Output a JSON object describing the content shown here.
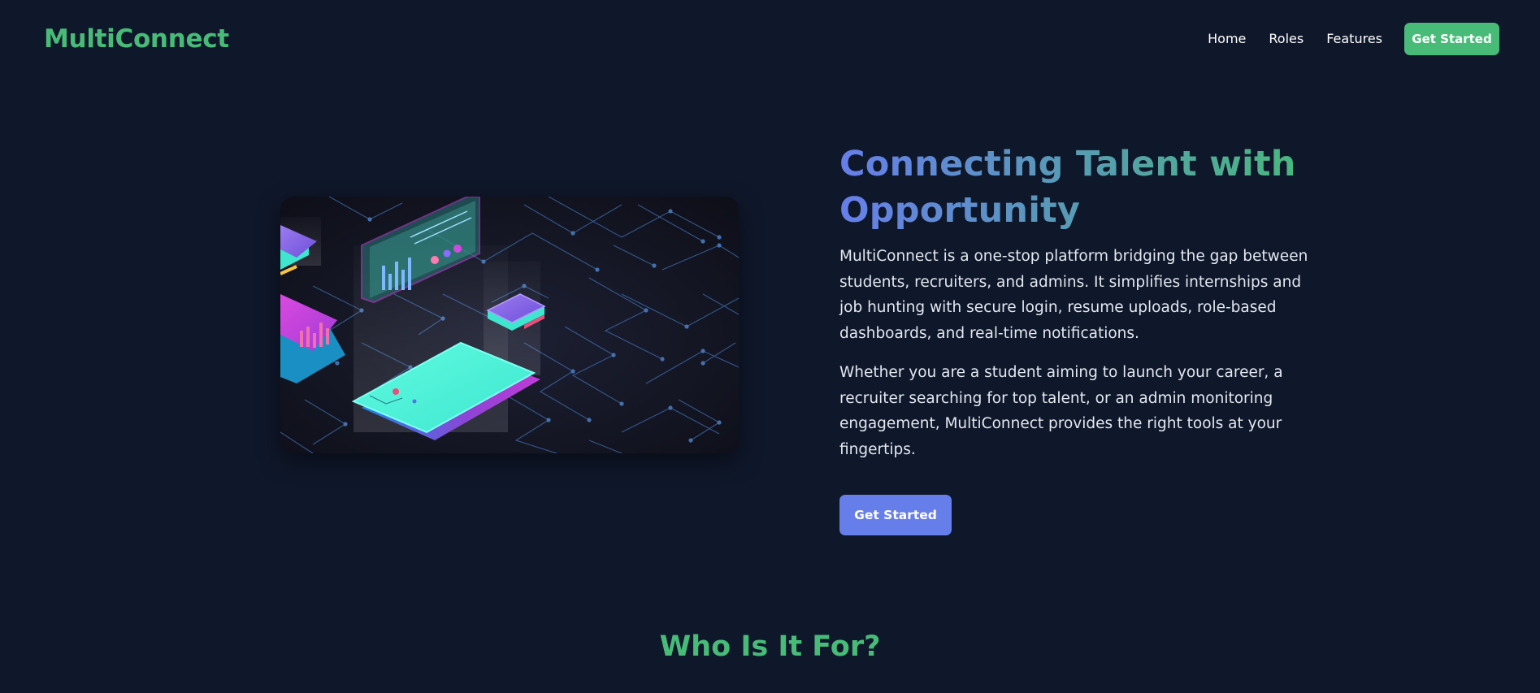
{
  "nav": {
    "brand": "MultiConnect",
    "links": [
      "Home",
      "Roles",
      "Features"
    ],
    "cta_label": "Get Started"
  },
  "hero": {
    "title": "Connecting Talent with Opportunity",
    "paragraphs": [
      "MultiConnect is a one-stop platform bridging the gap between students, recruiters, and admins. It simplifies internships and job hunting with secure login, resume uploads, role-based dashboards, and real-time notifications.",
      "Whether you are a student aiming to launch your career, a recruiter searching for top talent, or an admin monitoring engagement, MultiConnect provides the right tools at your fingertips."
    ],
    "cta_label": "Get Started",
    "image_icon": "isometric-tech-illustration"
  },
  "section": {
    "title": "Who Is It For?"
  },
  "colors": {
    "background": "#0f172a",
    "brand_green": "#48bb78",
    "accent_indigo": "#667eea",
    "text": "#e2e8f0"
  }
}
